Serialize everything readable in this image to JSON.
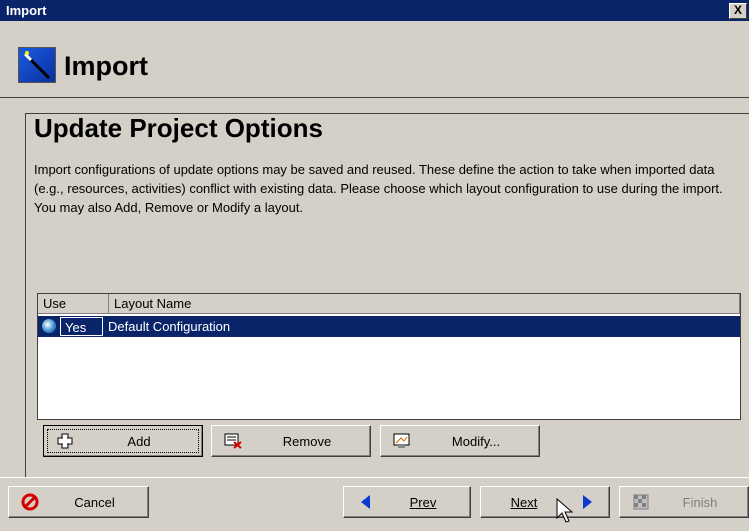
{
  "window": {
    "title": "Import",
    "close_glyph": "X"
  },
  "header": {
    "title": "Import",
    "icon": "wand-icon"
  },
  "section": {
    "heading": "Update Project Options",
    "description": "Import configurations of update options may be saved and reused.  These define the action to take when imported data (e.g., resources, activities) conflict with existing data.  Please choose which layout configuration to use during the import. You may also Add, Remove or Modify a layout."
  },
  "table": {
    "columns": [
      "Use",
      "Layout Name"
    ],
    "rows": [
      {
        "use": "Yes",
        "name": "Default Configuration",
        "selected": true
      }
    ]
  },
  "actions": {
    "add": "Add",
    "remove": "Remove",
    "modify": "Modify..."
  },
  "footer": {
    "cancel": "Cancel",
    "prev": "Prev",
    "next": "Next",
    "finish": "Finish"
  }
}
